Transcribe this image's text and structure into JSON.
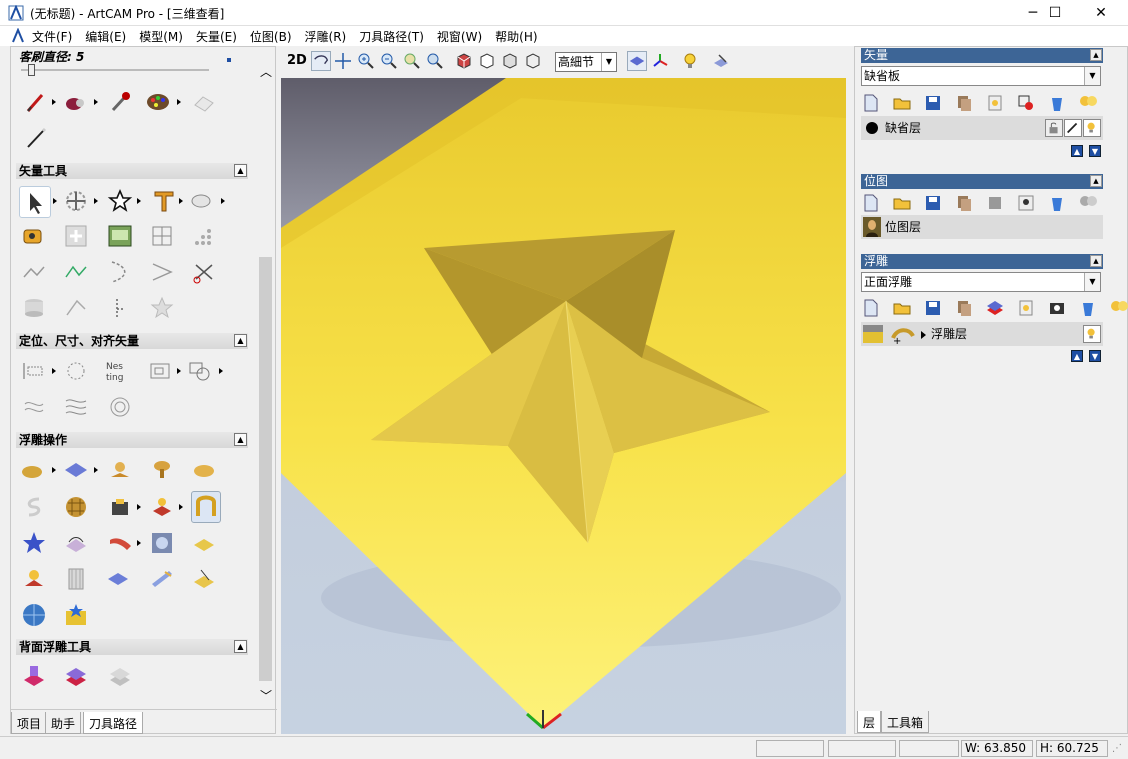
{
  "window": {
    "title": "(无标题) - ArtCAM Pro - [三维查看]",
    "minimize_glyph": "─",
    "maximize_glyph": "☐",
    "close_glyph": "✕"
  },
  "menu": {
    "items": [
      "文件(F)",
      "编辑(E)",
      "模型(M)",
      "矢量(E)",
      "位图(B)",
      "浮雕(R)",
      "刀具路径(T)",
      "视窗(W)",
      "帮助(H)"
    ],
    "mdi": [
      "_",
      "🗗",
      "✕"
    ]
  },
  "left": {
    "brush_label": "客刷直径: 5",
    "sections": {
      "vector_tools": "矢量工具",
      "position": "定位、尺寸、对齐矢量",
      "relief_ops": "浮雕操作",
      "back_relief": "背面浮雕工具"
    },
    "tabs": [
      "项目",
      "助手",
      "刀具路径"
    ]
  },
  "view": {
    "mode_2d": "2D",
    "quality": "高細节"
  },
  "right": {
    "vector_header": "矢量",
    "vector_combo": "缺省板",
    "vector_layer": "缺省层",
    "bitmap_header": "位图",
    "bitmap_layer": "位图层",
    "relief_header": "浮雕",
    "relief_combo": "正面浮雕",
    "relief_layer": "浮雕层",
    "tabs": [
      "层",
      "工具箱"
    ]
  },
  "status": {
    "width": "W: 63.850",
    "height": "H: 60.725"
  },
  "colors": {
    "relief_yellow": "#f2d43a",
    "header_blue": "#3d6596"
  }
}
